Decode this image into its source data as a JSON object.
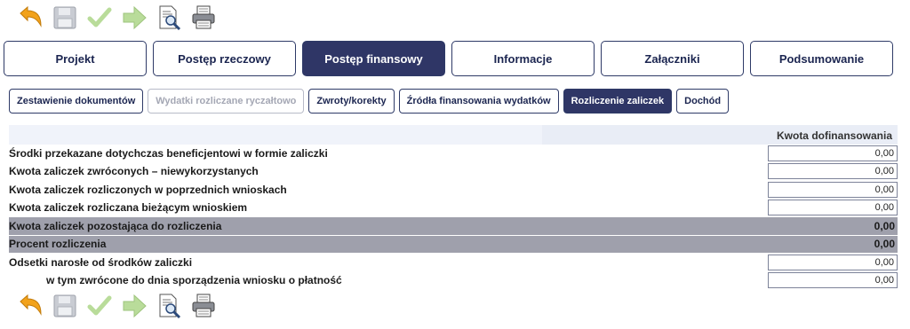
{
  "toolbar": {
    "icons": [
      "undo-arrow-icon",
      "save-disk-icon",
      "check-icon",
      "next-arrow-icon",
      "document-preview-icon",
      "print-icon"
    ]
  },
  "main_tabs": [
    {
      "label": "Projekt"
    },
    {
      "label": "Postęp rzeczowy"
    },
    {
      "label": "Postęp finansowy",
      "active": true
    },
    {
      "label": "Informacje"
    },
    {
      "label": "Załączniki"
    },
    {
      "label": "Podsumowanie"
    }
  ],
  "sub_tabs": [
    {
      "label": "Zestawienie dokumentów"
    },
    {
      "label": "Wydatki rozliczane ryczałtowo",
      "disabled": true
    },
    {
      "label": "Zwroty/korekty"
    },
    {
      "label": "Źródła finansowania wydatków"
    },
    {
      "label": "Rozliczenie zaliczek",
      "active": true
    },
    {
      "label": "Dochód"
    }
  ],
  "table": {
    "column_header": "Kwota dofinansowania",
    "rows": [
      {
        "label": "Środki przekazane dotychczas beneficjentowi w formie zaliczki",
        "value": "0,00"
      },
      {
        "label": "Kwota zaliczek zwróconych – niewykorzystanych",
        "value": "0,00"
      },
      {
        "label": "Kwota zaliczek rozliczonych w poprzednich wnioskach",
        "value": "0,00"
      },
      {
        "label": "Kwota zaliczek rozliczana bieżącym wnioskiem",
        "value": "0,00"
      },
      {
        "label": "Kwota zaliczek pozostająca do rozliczenia",
        "value": "0,00"
      },
      {
        "label": "Procent rozliczenia",
        "value": "0,00"
      },
      {
        "label": "Odsetki narosłe od środków zaliczki",
        "value": "0,00"
      },
      {
        "label": "w tym zwrócone do dnia sporządzenia wniosku o płatność",
        "value": "0,00"
      }
    ]
  },
  "colors": {
    "accent_dark": "#2f3666",
    "summary_row": "#9fa0ac"
  }
}
